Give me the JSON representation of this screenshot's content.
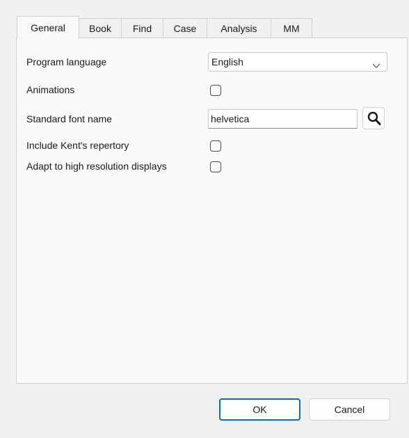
{
  "tabs": [
    {
      "label": "General",
      "active": true
    },
    {
      "label": "Book",
      "active": false
    },
    {
      "label": "Find",
      "active": false
    },
    {
      "label": "Case",
      "active": false
    },
    {
      "label": "Analysis",
      "active": false
    },
    {
      "label": "MM",
      "active": false
    }
  ],
  "general": {
    "program_language": {
      "label": "Program language",
      "value": "English"
    },
    "animations": {
      "label": "Animations",
      "checked": false
    },
    "standard_font": {
      "label": "Standard font name",
      "value": "helvetica",
      "button_icon": "search-icon"
    },
    "include_kent": {
      "label": "Include Kent's repertory",
      "checked": false
    },
    "high_res": {
      "label": "Adapt to high resolution displays",
      "checked": false
    }
  },
  "footer": {
    "ok_label": "OK",
    "cancel_label": "Cancel"
  },
  "colors": {
    "accent": "#0f6cbd",
    "window_bg": "#f0f0f0",
    "panel_bg": "#f9f9f9"
  }
}
